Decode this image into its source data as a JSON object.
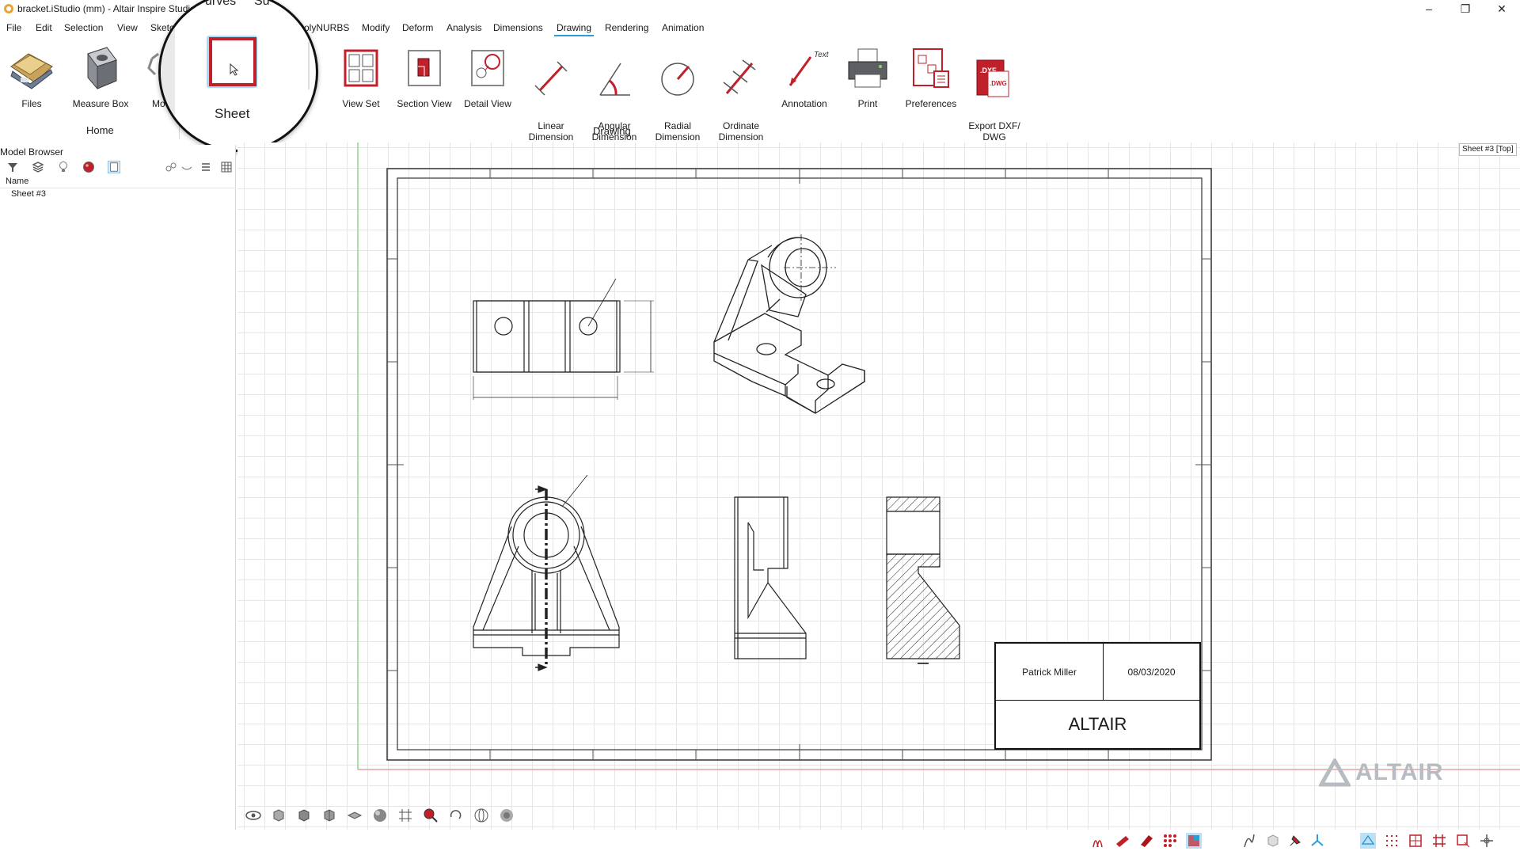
{
  "window": {
    "title": "bracket.iStudio (mm) - Altair Inspire Studio",
    "minimize": "–",
    "restore": "❐",
    "close": "✕"
  },
  "menu": [
    "File",
    "Edit",
    "Selection",
    "View",
    "Sketch",
    "PolyNURBS",
    "Modify",
    "Deform",
    "Analysis",
    "Dimensions",
    "Drawing",
    "Rendering",
    "Animation"
  ],
  "menu_active": "Drawing",
  "ribbon": {
    "home_tools": [
      {
        "label": "Files",
        "icon": "files-icon"
      },
      {
        "label": "Measure Box",
        "icon": "measure-box-icon"
      },
      {
        "label": "Mo",
        "icon": "move-icon"
      }
    ],
    "home_group": "Home",
    "drawing_tools": [
      {
        "label": "View Set",
        "icon": "view-set-icon"
      },
      {
        "label": "Section View",
        "icon": "section-view-icon"
      },
      {
        "label": "Detail View",
        "icon": "detail-view-icon"
      },
      {
        "label": "Linear\nDimension",
        "icon": "linear-dimension-icon"
      },
      {
        "label": "Angular\nDimension",
        "icon": "angular-dimension-icon"
      },
      {
        "label": "Radial\nDimension",
        "icon": "radial-dimension-icon"
      },
      {
        "label": "Ordinate\nDimension",
        "icon": "ordinate-dimension-icon"
      },
      {
        "label": "Annotation",
        "icon": "annotation-icon"
      },
      {
        "label": "Print",
        "icon": "print-icon"
      },
      {
        "label": "Preferences",
        "icon": "preferences-icon"
      },
      {
        "label": "Export DXF/\nDWG",
        "icon": "export-dxf-icon"
      }
    ],
    "drawing_group": "Drawing",
    "annotation_icon_text": "Text",
    "dxf_icon_text": ".DXF\n.DWG"
  },
  "magnifier": {
    "tool_label": "Sheet",
    "partial_top_left": "urves",
    "partial_top_right": "Su"
  },
  "model_browser": {
    "title": "Model Browser",
    "column_header": "Name",
    "items": [
      "Sheet #3"
    ]
  },
  "viewport": {
    "view_label": "Sheet #3 [Top]"
  },
  "title_block": {
    "author": "Patrick Miller",
    "date": "08/03/2020",
    "company": "ALTAIR"
  },
  "watermark": "ALTAIR",
  "colors": {
    "accent": "#2a9fd6",
    "icon_red": "#c0202a",
    "sheet_border": "#333333",
    "watermark": "#b7bcc2"
  }
}
